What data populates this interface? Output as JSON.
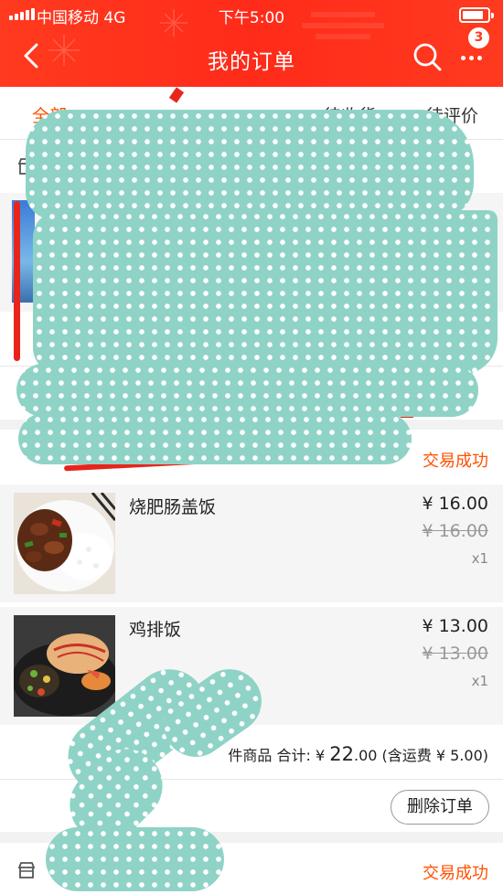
{
  "statusbar": {
    "carrier": "中国移动  4G",
    "time": "下午5:00"
  },
  "nav": {
    "title": "我的订单",
    "notification_count": "3"
  },
  "tabs": [
    {
      "label": "全部",
      "active": true
    },
    {
      "label": "待收货",
      "active": false
    },
    {
      "label": "待评价",
      "active": false
    }
  ],
  "orders": [
    {
      "status": "交易成功",
      "items": [
        {
          "name": "烧肥肠盖饭",
          "price": "¥ 16.00",
          "original_price": "¥ 16.00",
          "quantity": "x1"
        },
        {
          "name": "鸡排饭",
          "price": "¥ 13.00",
          "original_price": "¥ 13.00",
          "quantity": "x1"
        }
      ],
      "summary": {
        "count_text": "件商品",
        "total_label": "合计: ",
        "currency": "¥ ",
        "total_integer": "22",
        "total_decimal": ".00",
        "shipping": " (含运费 ¥ 5.00)"
      },
      "delete_button": "删除订单"
    },
    {
      "status": "交易成功"
    }
  ],
  "colors": {
    "header": "#ff2b1a",
    "accent": "#ff5000",
    "mask": "#8fd3c6"
  }
}
